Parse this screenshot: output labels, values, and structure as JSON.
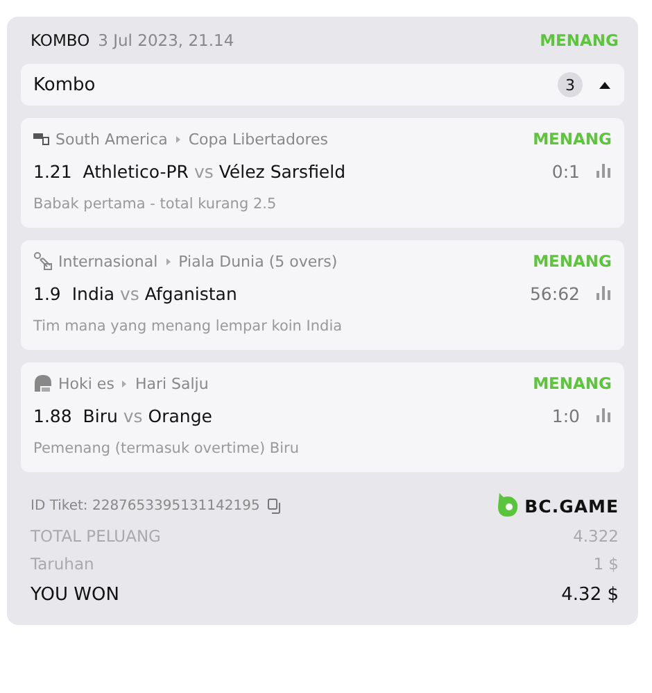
{
  "header": {
    "bet_type": "KOMBO",
    "date": "3 Jul 2023, 21.14",
    "status": "MENANG"
  },
  "combo": {
    "label": "Kombo",
    "count": "3",
    "expanded": true
  },
  "bets": [
    {
      "kind": "soccer",
      "region": "South America",
      "league": "Copa Libertadores",
      "status": "MENANG",
      "odds": "1.21",
      "home": "Athletico-PR",
      "vs": "vs",
      "away": "Vélez Sarsfield",
      "score": "0:1",
      "market": "Babak pertama - total kurang 2.5"
    },
    {
      "kind": "cricket",
      "region": "Internasional",
      "league": "Piala Dunia (5 overs)",
      "status": "MENANG",
      "odds": "1.9",
      "home": "India",
      "vs": "vs",
      "away": "Afganistan",
      "score": "56:62",
      "market": "Tim mana yang menang lempar koin India"
    },
    {
      "kind": "hockey",
      "region": "Hoki es",
      "league": "Hari Salju",
      "status": "MENANG",
      "odds": "1.88",
      "home": "Biru",
      "vs": "vs",
      "away": "Orange",
      "score": "1:0",
      "market": "Pemenang (termasuk overtime) Biru"
    }
  ],
  "ticket": {
    "id": "ID Tiket: 2287653395131142195",
    "brand": "BC.GAME"
  },
  "summary": [
    {
      "kind": "muted",
      "label": "TOTAL PELUANG",
      "value": "4.322"
    },
    {
      "kind": "muted",
      "label": "Taruhan",
      "value": "1 $"
    },
    {
      "kind": "total",
      "label": "YOU WON",
      "value": "4.32 $"
    }
  ]
}
